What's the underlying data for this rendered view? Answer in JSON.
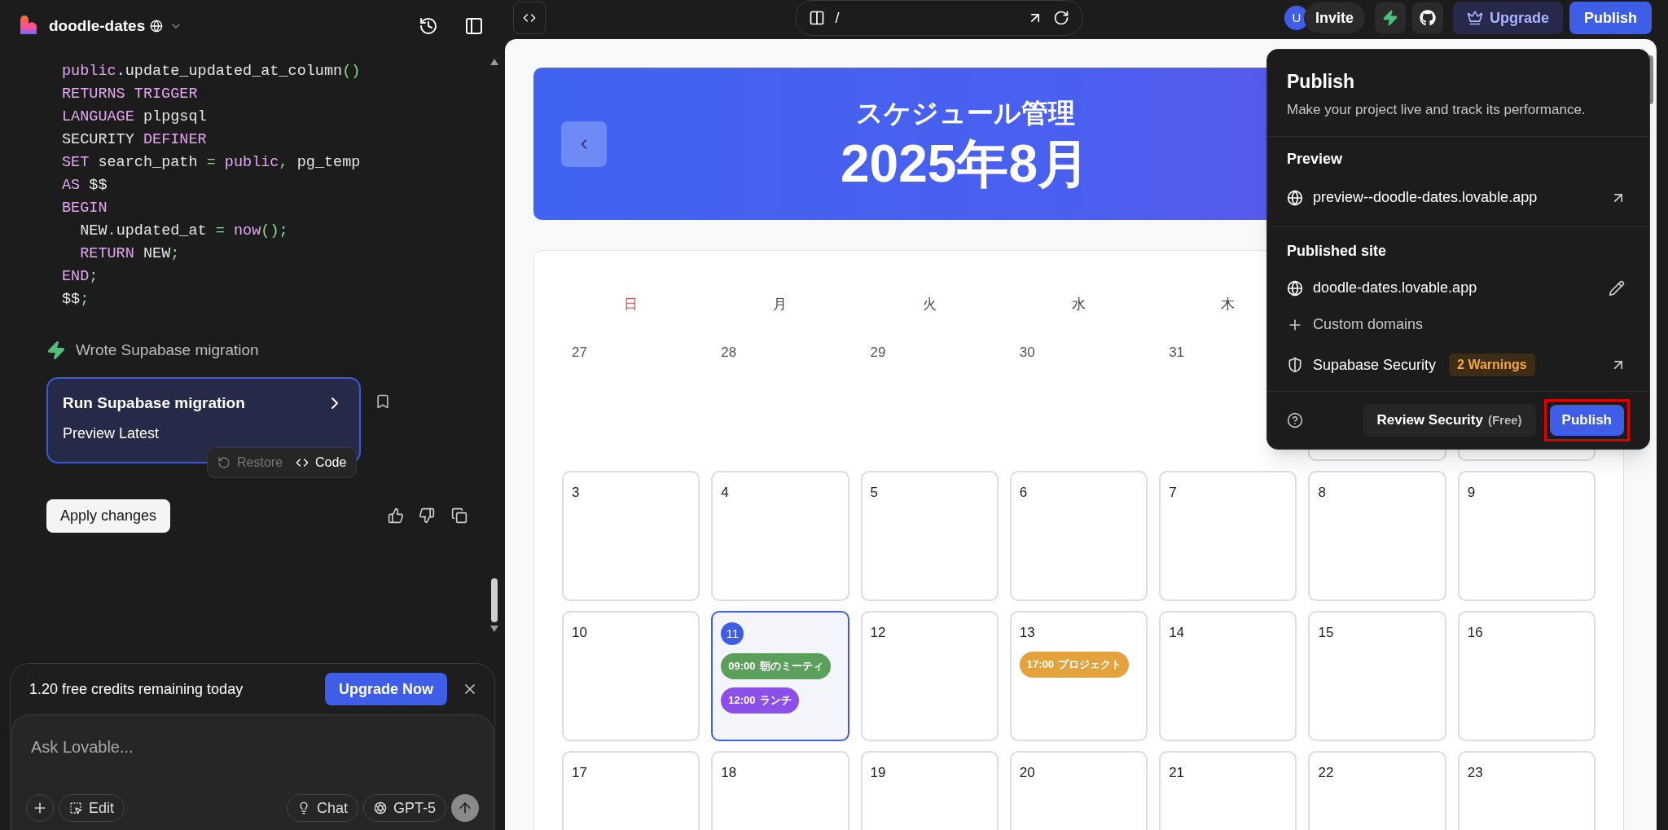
{
  "project": {
    "name": "doodle-dates"
  },
  "code_lines": [
    [
      {
        "text": "public",
        "kind": "keyword"
      },
      {
        "text": ".update_updated_at_column",
        "kind": "plain"
      },
      {
        "text": "()",
        "kind": "punct"
      }
    ],
    [
      {
        "text": "RETURNS TRIGGER",
        "kind": "keyword"
      }
    ],
    [
      {
        "text": "LANGUAGE",
        "kind": "keyword"
      },
      {
        "text": " plpgsql",
        "kind": "plain"
      }
    ],
    [
      {
        "text": "SECURITY",
        "kind": "plain"
      },
      {
        "text": " DEFINER",
        "kind": "keyword"
      }
    ],
    [
      {
        "text": "SET",
        "kind": "keyword"
      },
      {
        "text": " search_path ",
        "kind": "plain"
      },
      {
        "text": "=",
        "kind": "punct"
      },
      {
        "text": " public",
        "kind": "keyword"
      },
      {
        "text": ",",
        "kind": "punct"
      },
      {
        "text": " pg_temp",
        "kind": "plain"
      }
    ],
    [
      {
        "text": "AS",
        "kind": "keyword"
      },
      {
        "text": " $$",
        "kind": "plain"
      }
    ],
    [
      {
        "text": "BEGIN",
        "kind": "keyword"
      }
    ],
    [
      {
        "text": "  NEW",
        "kind": "plain"
      },
      {
        "text": ".",
        "kind": "punct"
      },
      {
        "text": "updated_at ",
        "kind": "plain"
      },
      {
        "text": "=",
        "kind": "punct"
      },
      {
        "text": " now",
        "kind": "keyword"
      },
      {
        "text": "();",
        "kind": "punct"
      }
    ],
    [
      {
        "text": "  RETURN",
        "kind": "keyword"
      },
      {
        "text": " NEW",
        "kind": "plain"
      },
      {
        "text": ";",
        "kind": "punct"
      }
    ],
    [
      {
        "text": "END",
        "kind": "keyword"
      },
      {
        "text": ";",
        "kind": "punct"
      }
    ],
    [
      {
        "text": "$$",
        "kind": "plain"
      },
      {
        "text": ";",
        "kind": "punct"
      }
    ]
  ],
  "activity": {
    "label": "Wrote Supabase migration"
  },
  "version_card": {
    "title": "Run Supabase migration",
    "subtitle": "Preview Latest",
    "actions": [
      {
        "label": "Restore",
        "disabled": true
      },
      {
        "label": "Code",
        "disabled": false
      }
    ]
  },
  "apply_button": "Apply changes",
  "credits_banner": {
    "text": "1.20 free credits remaining today",
    "button": "Upgrade Now"
  },
  "composer": {
    "placeholder": "Ask Lovable...",
    "edit": "Edit",
    "mode": "Chat",
    "model": "GPT-5"
  },
  "top_bar": {
    "path": "/",
    "avatar": "U",
    "invite": "Invite",
    "upgrade": "Upgrade",
    "publish": "Publish"
  },
  "calendar": {
    "title": "スケジュール管理",
    "month": "2025年8月",
    "weekdays": [
      {
        "label": "日",
        "holiday": true
      },
      {
        "label": "月",
        "holiday": false
      },
      {
        "label": "火",
        "holiday": false
      },
      {
        "label": "水",
        "holiday": false
      },
      {
        "label": "木",
        "holiday": false
      }
    ],
    "weeks": [
      [
        {
          "day": "27",
          "in_month": false
        },
        {
          "day": "28",
          "in_month": false
        },
        {
          "day": "29",
          "in_month": false
        },
        {
          "day": "30",
          "in_month": false
        },
        {
          "day": "31",
          "in_month": false
        },
        {
          "in_month": true
        },
        {
          "in_month": true
        }
      ],
      [
        {
          "day": "3",
          "in_month": true
        },
        {
          "day": "4",
          "in_month": true
        },
        {
          "day": "5",
          "in_month": true
        },
        {
          "day": "6",
          "in_month": true
        },
        {
          "day": "7",
          "in_month": true
        },
        {
          "day": "8",
          "in_month": true
        },
        {
          "day": "9",
          "in_month": true
        }
      ],
      [
        {
          "day": "10",
          "in_month": true
        },
        {
          "day": "11",
          "in_month": true,
          "today": true,
          "events": [
            {
              "time": "09:00",
              "title": "朝のミーティ",
              "color": "#5aa05a"
            },
            {
              "time": "12:00",
              "title": "ランチ",
              "color": "#8c4fe8"
            }
          ]
        },
        {
          "day": "12",
          "in_month": true
        },
        {
          "day": "13",
          "in_month": true,
          "events": [
            {
              "time": "17:00",
              "title": "プロジェクト",
              "color": "#e4a23c"
            }
          ]
        },
        {
          "day": "14",
          "in_month": true
        },
        {
          "day": "15",
          "in_month": true
        },
        {
          "day": "16",
          "in_month": true
        }
      ],
      [
        {
          "day": "17",
          "in_month": true
        },
        {
          "day": "18",
          "in_month": true
        },
        {
          "day": "19",
          "in_month": true
        },
        {
          "day": "20",
          "in_month": true
        },
        {
          "day": "21",
          "in_month": true
        },
        {
          "day": "22",
          "in_month": true
        },
        {
          "day": "23",
          "in_month": true
        }
      ]
    ]
  },
  "publish_popover": {
    "title": "Publish",
    "subtitle": "Make your project live and track its performance.",
    "preview": {
      "heading": "Preview",
      "url": "preview--doodle-dates.lovable.app"
    },
    "published": {
      "heading": "Published site",
      "url": "doodle-dates.lovable.app",
      "custom_domains": "Custom domains"
    },
    "security": {
      "label": "Supabase Security",
      "badge": "2 Warnings"
    },
    "review_button": {
      "label": "Review Security",
      "note": "(Free)"
    },
    "publish_button": {
      "label": "Publish",
      "highlighted": true
    }
  }
}
